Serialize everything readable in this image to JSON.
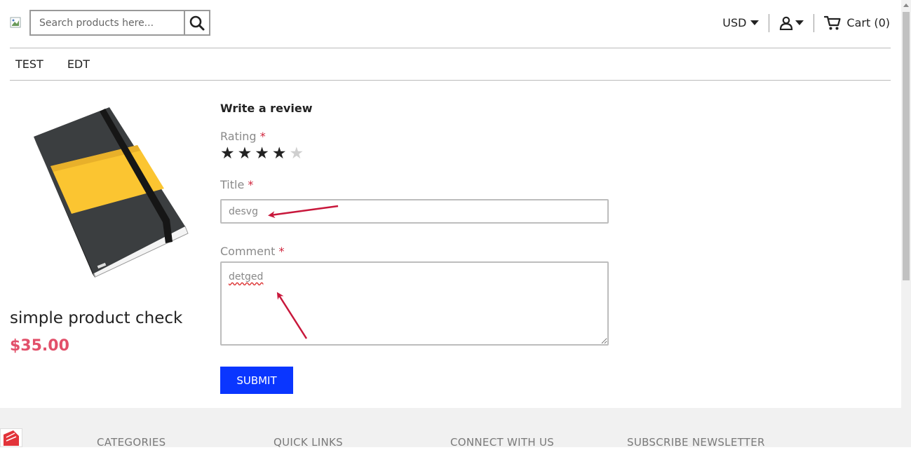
{
  "header": {
    "search": {
      "placeholder": "Search products here..."
    },
    "currency": "USD",
    "cart_label": "Cart (0)"
  },
  "nav": {
    "items": [
      "TEST",
      "EDT"
    ]
  },
  "product": {
    "name": "simple product check",
    "price": "$35.00",
    "image_icon": "notebook-image"
  },
  "review": {
    "heading": "Write a review",
    "rating_label": "Rating",
    "rating": 4,
    "rating_max": 5,
    "title_label": "Title",
    "title_value": "desvg",
    "comment_label": "Comment",
    "comment_value": "detged",
    "required_mark": "*",
    "submit_label": "SUBMIT"
  },
  "footer": {
    "columns": [
      "CATEGORIES",
      "QUICK LINKS",
      "CONNECT WITH US",
      "SUBSCRIBE NEWSLETTER"
    ]
  },
  "colors": {
    "price": "#e2506a",
    "submit_bg": "#0a36ff",
    "required": "#d0243c",
    "annotation_arrow": "#c8173b"
  }
}
